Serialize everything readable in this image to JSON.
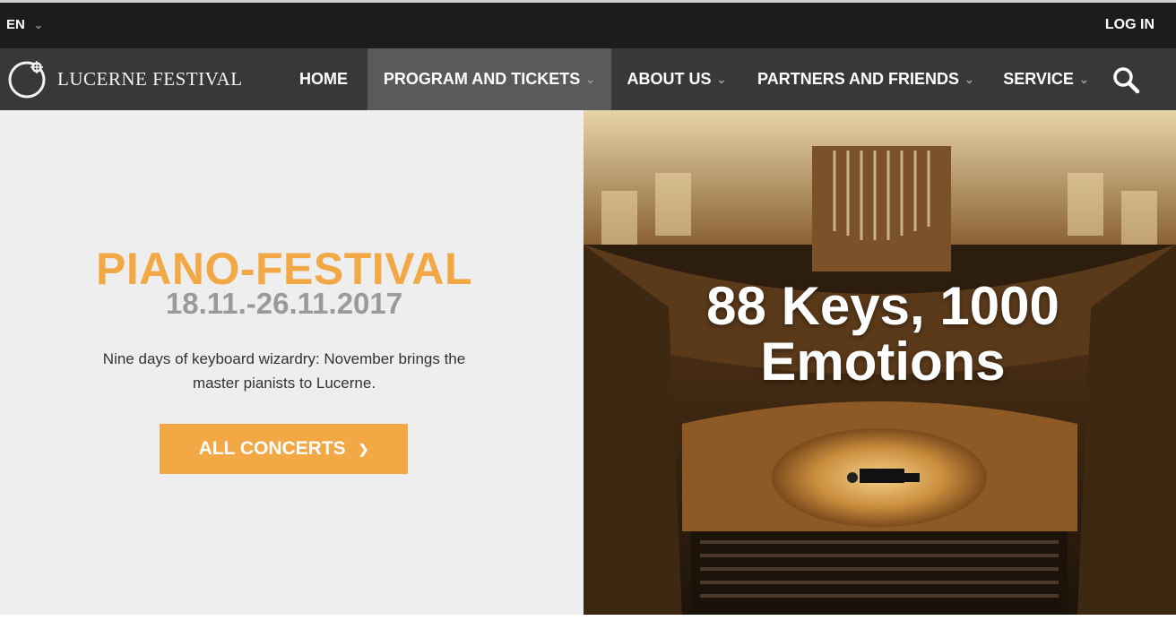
{
  "topbar": {
    "language": "EN",
    "login_label": "LOG IN"
  },
  "brand": {
    "name": "LUCERNE FESTIVAL"
  },
  "nav": {
    "items": [
      {
        "label": "HOME",
        "has_dropdown": false
      },
      {
        "label": "PROGRAM AND TICKETS",
        "has_dropdown": true,
        "active": true
      },
      {
        "label": "ABOUT US",
        "has_dropdown": true
      },
      {
        "label": "PARTNERS AND FRIENDS",
        "has_dropdown": true
      },
      {
        "label": "SERVICE",
        "has_dropdown": true
      }
    ],
    "search_icon": "search-icon"
  },
  "hero": {
    "title": "PIANO-FESTIVAL",
    "dates": "18.11.-26.11.2017",
    "description": "Nine days of keyboard wizardry: November brings the master pianists to Lucerne.",
    "cta_label": "ALL CONCERTS",
    "image_headline": "88 Keys, 1000 Emotions"
  },
  "colors": {
    "accent": "#f1a845",
    "topbar_bg": "#1c1c1c",
    "nav_bg": "#383838",
    "nav_active_bg": "#5a5a5a",
    "hero_left_bg": "#eeeeee",
    "dates_gray": "#9a9a9a"
  }
}
